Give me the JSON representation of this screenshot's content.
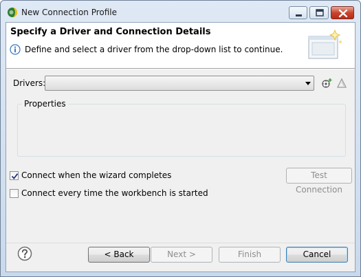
{
  "window": {
    "title": "New Connection Profile",
    "icons": {
      "app": "eclipse-datatools-icon",
      "minimize": "minimize-icon",
      "maximize": "maximize-icon",
      "close": "close-icon"
    },
    "colors": {
      "close_button": "#c9462f",
      "titlebar": "#dfe9f5"
    }
  },
  "banner": {
    "title": "Specify a Driver and Connection Details",
    "description": "Define and select a driver from the drop-down list to continue.",
    "info_icon": "info-icon",
    "wizard_image": "wizard-banner-icon"
  },
  "drivers": {
    "label": "Drivers:",
    "selected": "",
    "new_driver_icon": "new-driver-icon",
    "edit_driver_icon": "edit-driver-icon"
  },
  "properties": {
    "legend": "Properties"
  },
  "options": {
    "connect_on_finish": {
      "label": "Connect when the wizard completes",
      "checked": true
    },
    "connect_on_startup": {
      "label": "Connect every time the workbench is started",
      "checked": false
    }
  },
  "buttons": {
    "test_connection": "Test Connection",
    "back": "< Back",
    "next": "Next >",
    "finish": "Finish",
    "cancel": "Cancel",
    "help_icon": "help-icon"
  }
}
